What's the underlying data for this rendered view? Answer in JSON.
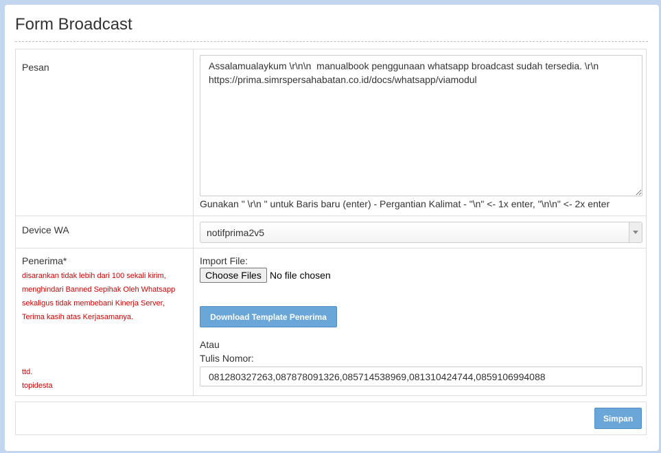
{
  "title": "Form Broadcast",
  "pesan": {
    "label": "Pesan",
    "message": "Assalamualaykum \\r\\n\\n  manualbook penggunaan whatsapp broadcast sudah tersedia. \\r\\n https://prima.simrspersahabatan.co.id/docs/whatsapp/viamodul",
    "hint": "Gunakan \" \\r\\n \" untuk Baris baru (enter) - Pergantian Kalimat - \"\\n\" <- 1x enter, \"\\n\\n\" <- 2x enter"
  },
  "device": {
    "label": "Device WA",
    "selected": "notifprima2v5"
  },
  "penerima": {
    "label": "Penerima*",
    "notes": [
      "disarankan tidak lebih dari 100 sekali kirim,",
      "menghindari Banned Sepihak Oleh Whatsapp",
      "sekaligus tidak membebani Kinerja Server,",
      "Terima kasih atas Kerjasamanya."
    ],
    "signature": [
      "ttd.",
      "topidesta"
    ],
    "import_label": "Import File:",
    "choose_files": "Choose Files",
    "file_status": "No file chosen",
    "download_template": "Download Template Penerima",
    "atau": "Atau",
    "tulis_nomor_label": "Tulis Nomor:",
    "numbers_value": "081280327263,087878091326,085714538969,081310424744,0859106994088"
  },
  "submit_label": "Simpan"
}
